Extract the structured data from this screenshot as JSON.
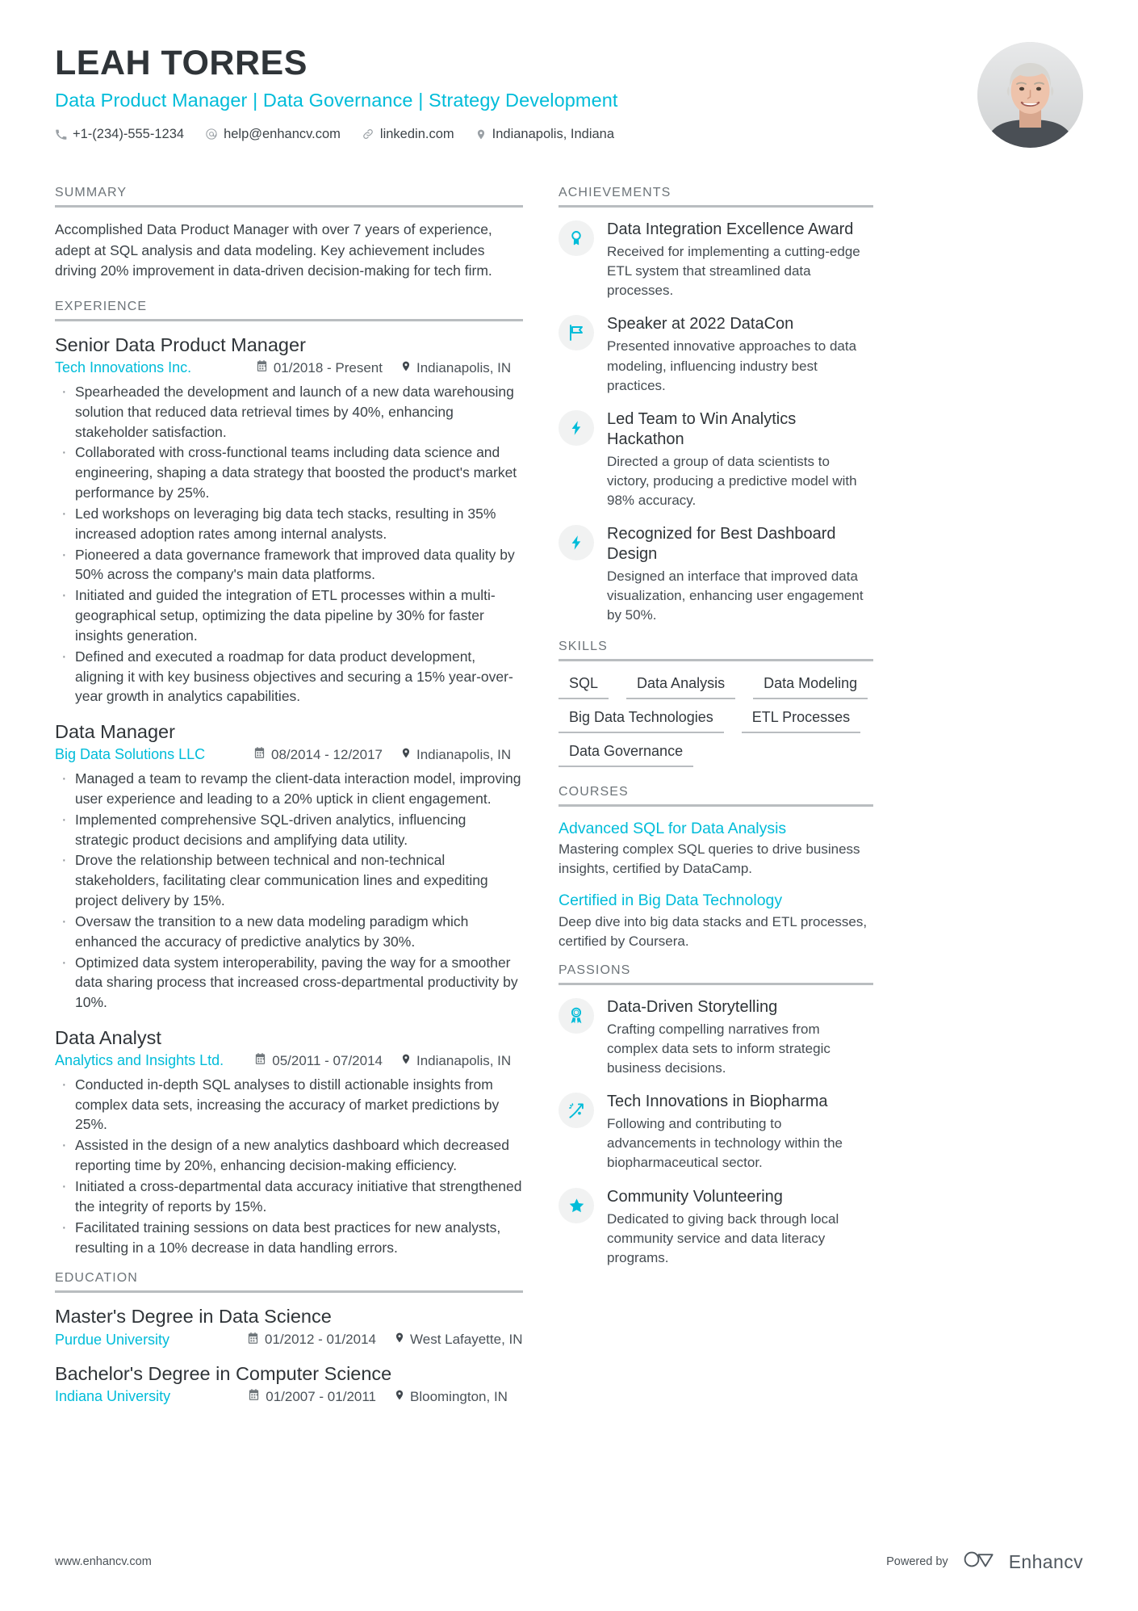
{
  "header": {
    "name": "LEAH TORRES",
    "headline": "Data Product Manager | Data Governance | Strategy Development",
    "contacts": [
      {
        "icon": "phone-icon",
        "text": "+1-(234)-555-1234"
      },
      {
        "icon": "at-email-icon",
        "text": "help@enhancv.com"
      },
      {
        "icon": "link-icon",
        "text": "linkedin.com"
      },
      {
        "icon": "location-pin-icon",
        "text": "Indianapolis, Indiana"
      }
    ],
    "avatar_alt": "portrait-photo"
  },
  "colors": {
    "accent": "#00bcd9",
    "heading": "#2f3438",
    "body": "#3c4348",
    "rule": "#b9bdc0",
    "icon_bg": "#f1f2f2"
  },
  "sections": {
    "summary": {
      "title": "SUMMARY",
      "text": "Accomplished Data Product Manager with over 7 years of experience, adept at SQL analysis and data modeling. Key achievement includes driving 20% improvement in data-driven decision-making for tech firm."
    },
    "experience": {
      "title": "EXPERIENCE",
      "entries": [
        {
          "role": "Senior Data Product Manager",
          "org": "Tech Innovations Inc.",
          "dates": "01/2018 - Present",
          "location": "Indianapolis, IN",
          "bullets": [
            "Spearheaded the development and launch of a new data warehousing solution that reduced data retrieval times by 40%, enhancing stakeholder satisfaction.",
            "Collaborated with cross-functional teams including data science and engineering, shaping a data strategy that boosted the product's market performance by 25%.",
            "Led workshops on leveraging big data tech stacks, resulting in 35% increased adoption rates among internal analysts.",
            "Pioneered a data governance framework that improved data quality by 50% across the company's main data platforms.",
            "Initiated and guided the integration of ETL processes within a multi-geographical setup, optimizing the data pipeline by 30% for faster insights generation.",
            "Defined and executed a roadmap for data product development, aligning it with key business objectives and securing a 15% year-over-year growth in analytics capabilities."
          ]
        },
        {
          "role": "Data Manager",
          "org": "Big Data Solutions LLC",
          "dates": "08/2014 - 12/2017",
          "location": "Indianapolis, IN",
          "bullets": [
            "Managed a team to revamp the client-data interaction model, improving user experience and leading to a 20% uptick in client engagement.",
            "Implemented comprehensive SQL-driven analytics, influencing strategic product decisions and amplifying data utility.",
            "Drove the relationship between technical and non-technical stakeholders, facilitating clear communication lines and expediting project delivery by 15%.",
            "Oversaw the transition to a new data modeling paradigm which enhanced the accuracy of predictive analytics by 30%.",
            "Optimized data system interoperability, paving the way for a smoother data sharing process that increased cross-departmental productivity by 10%."
          ]
        },
        {
          "role": "Data Analyst",
          "org": "Analytics and Insights Ltd.",
          "dates": "05/2011 - 07/2014",
          "location": "Indianapolis, IN",
          "bullets": [
            "Conducted in-depth SQL analyses to distill actionable insights from complex data sets, increasing the accuracy of market predictions by 25%.",
            "Assisted in the design of a new analytics dashboard which decreased reporting time by 20%, enhancing decision-making efficiency.",
            "Initiated a cross-departmental data accuracy initiative that strengthened the integrity of reports by 15%.",
            "Facilitated training sessions on data best practices for new analysts, resulting in a 10% decrease in data handling errors."
          ]
        }
      ]
    },
    "education": {
      "title": "EDUCATION",
      "entries": [
        {
          "degree": "Master's Degree in Data Science",
          "school": "Purdue University",
          "dates": "01/2012 - 01/2014",
          "location": "West Lafayette, IN"
        },
        {
          "degree": "Bachelor's Degree in Computer Science",
          "school": "Indiana University",
          "dates": "01/2007 - 01/2011",
          "location": "Bloomington, IN"
        }
      ]
    },
    "achievements": {
      "title": "ACHIEVEMENTS",
      "items": [
        {
          "icon": "award-medal-icon",
          "title": "Data Integration Excellence Award",
          "desc": "Received for implementing a cutting-edge ETL system that streamlined data processes."
        },
        {
          "icon": "flag-icon",
          "title": "Speaker at 2022 DataCon",
          "desc": "Presented innovative approaches to data modeling, influencing industry best practices."
        },
        {
          "icon": "lightning-bolt-icon",
          "title": "Led Team to Win Analytics Hackathon",
          "desc": "Directed a group of data scientists to victory, producing a predictive model with 98% accuracy."
        },
        {
          "icon": "lightning-bolt-icon",
          "title": "Recognized for Best Dashboard Design",
          "desc": "Designed an interface that improved data visualization, enhancing user engagement by 50%."
        }
      ]
    },
    "skills": {
      "title": "SKILLS",
      "items": [
        "SQL",
        "Data Analysis",
        "Data Modeling",
        "Big Data Technologies",
        "ETL Processes",
        "Data Governance"
      ]
    },
    "courses": {
      "title": "COURSES",
      "items": [
        {
          "title": "Advanced SQL for Data Analysis",
          "desc": "Mastering complex SQL queries to drive business insights, certified by DataCamp."
        },
        {
          "title": "Certified in Big Data Technology",
          "desc": "Deep dive into big data stacks and ETL processes, certified by Coursera."
        }
      ]
    },
    "passions": {
      "title": "PASSIONS",
      "items": [
        {
          "icon": "ribbon-badge-icon",
          "title": "Data-Driven Storytelling",
          "desc": "Crafting compelling narratives from complex data sets to inform strategic business decisions."
        },
        {
          "icon": "rocket-trajectory-icon",
          "title": "Tech Innovations in Biopharma",
          "desc": "Following and contributing to advancements in technology within the biopharmaceutical sector."
        },
        {
          "icon": "star-icon",
          "title": "Community Volunteering",
          "desc": "Dedicated to giving back through local community service and data literacy programs."
        }
      ]
    }
  },
  "footer": {
    "website": "www.enhancv.com",
    "powered_by": "Powered by",
    "brand": "Enhancv"
  }
}
